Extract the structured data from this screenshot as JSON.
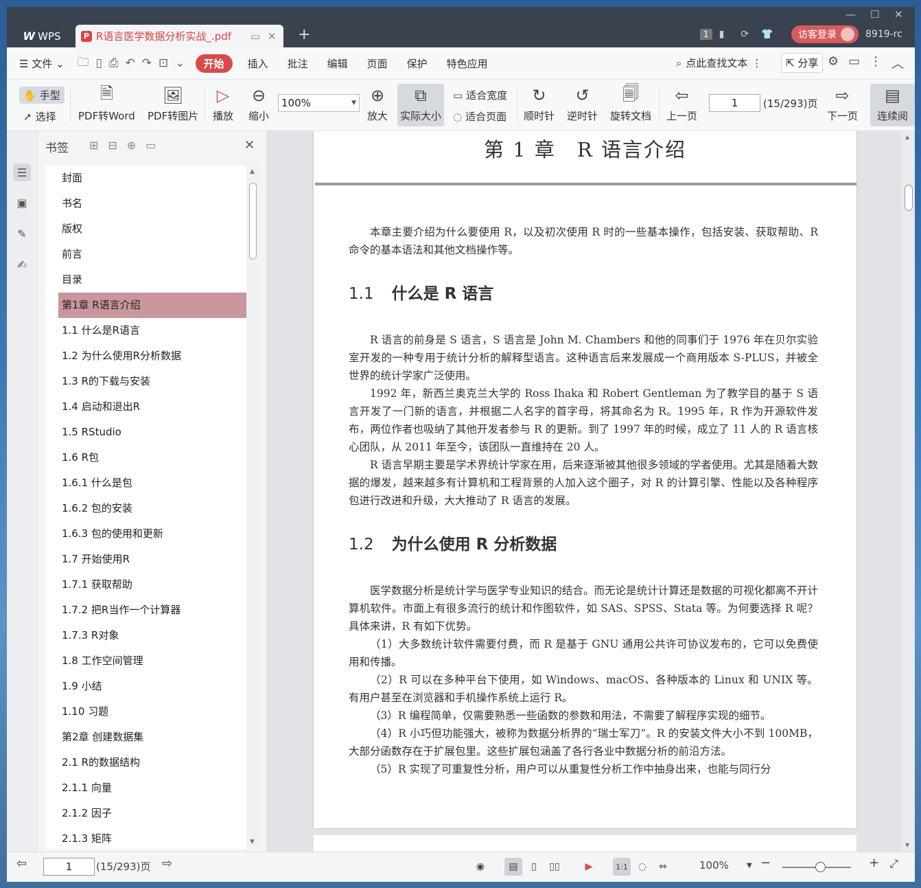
{
  "window": {
    "brand": "WPS",
    "doc_tab": "R语言医学数据分析实战_.pdf",
    "page_badge": "1",
    "login": "访客登录",
    "user": "8919-rc"
  },
  "menu": {
    "file": "文件",
    "tabs": [
      "开始",
      "插入",
      "批注",
      "编辑",
      "页面",
      "保护",
      "特色应用"
    ],
    "search": "点此查找文本",
    "share": "分享"
  },
  "toolbar": {
    "hand": "手型",
    "select": "选择",
    "pdf2word": "PDF转Word",
    "pdf2img": "PDF转图片",
    "play": "播放",
    "zoom_out": "缩小",
    "zoom_value": "100%",
    "zoom_in": "放大",
    "actual_size": "实际大小",
    "fit_width": "适合宽度",
    "fit_page": "适合页面",
    "cw": "顺时针",
    "ccw": "逆时针",
    "rotate_doc": "旋转文档",
    "prev": "上一页",
    "page": "1",
    "page_total": "(15/293)页",
    "next": "下一页",
    "continuous": "连续阅"
  },
  "bookmarks": {
    "title": "书签",
    "items": [
      "封面",
      "书名",
      "版权",
      "前言",
      "目录",
      "第1章 R语言介绍",
      "1.1 什么是R语言",
      "1.2 为什么使用R分析数据",
      "1.3 R的下载与安装",
      "1.4 启动和退出R",
      "1.5 RStudio",
      "1.6 R包",
      "1.6.1 什么是包",
      "1.6.2 包的安装",
      "1.6.3 包的使用和更新",
      "1.7 开始使用R",
      "1.7.1 获取帮助",
      "1.7.2 把R当作一个计算器",
      "1.7.3 R对象",
      "1.8 工作空间管理",
      "1.9 小结",
      "1.10 习题",
      "第2章 创建数据集",
      "2.1 R的数据结构",
      "2.1.1 向量",
      "2.1.2 因子",
      "2.1.3 矩阵"
    ],
    "selected_index": 5
  },
  "document": {
    "chapter_title": "第 1 章　R 语言介绍",
    "intro": "本章主要介绍为什么要使用 R，以及初次使用 R 时的一些基本操作，包括安装、获取帮助、R 命令的基本语法和其他文档操作等。",
    "s1_num": "1.1",
    "s1_title": "什么是 R 语言",
    "s1_p1": "R 语言的前身是 S 语言，S 语言是 John M. Chambers 和他的同事们于 1976 年在贝尔实验室开发的一种专用于统计分析的解释型语言。这种语言后来发展成一个商用版本 S-PLUS，并被全世界的统计学家广泛使用。",
    "s1_p2": "1992 年，新西兰奥克兰大学的 Ross Ihaka 和 Robert Gentleman 为了教学目的基于 S 语言开发了一门新的语言，并根据二人名字的首字母，将其命名为 R。1995 年，R 作为开源软件发布，两位作者也吸纳了其他开发者参与 R 的更新。到了 1997 年的时候，成立了 11 人的 R 语言核心团队，从 2011 年至今，该团队一直维持在 20 人。",
    "s1_p3": "R 语言早期主要是学术界统计学家在用，后来逐渐被其他很多领域的学者使用。尤其是随着大数据的爆发，越来越多有计算机和工程背景的人加入这个圈子，对 R 的计算引擎、性能以及各种程序包进行改进和升级，大大推动了 R 语言的发展。",
    "s2_num": "1.2",
    "s2_title": "为什么使用 R 分析数据",
    "s2_p1": "医学数据分析是统计学与医学专业知识的结合。而无论是统计计算还是数据的可视化都离不开计算机软件。市面上有很多流行的统计和作图软件，如 SAS、SPSS、Stata 等。为何要选择 R 呢？具体来讲，R 有如下优势。",
    "s2_p2": "（1）大多数统计软件需要付费，而 R 是基于 GNU 通用公共许可协议发布的，它可以免费使用和传播。",
    "s2_p3": "（2）R 可以在多种平台下使用，如 Windows、macOS、各种版本的 Linux 和 UNIX 等。有用户甚至在浏览器和手机操作系统上运行 R。",
    "s2_p4": "（3）R 编程简单，仅需要熟悉一些函数的参数和用法，不需要了解程序实现的细节。",
    "s2_p5": "（4）R 小巧但功能强大，被称为数据分析界的“瑞士军刀”。R 的安装文件大小不到 100MB，大部分函数存在于扩展包里。这些扩展包涵盖了各行各业中数据分析的前沿方法。",
    "s2_p6": "（5）R 实现了可重复性分析，用户可以从重复性分析工作中抽身出来，也能与同行分"
  },
  "status": {
    "page": "1",
    "page_total": "(15/293)页",
    "zoom": "100%"
  }
}
